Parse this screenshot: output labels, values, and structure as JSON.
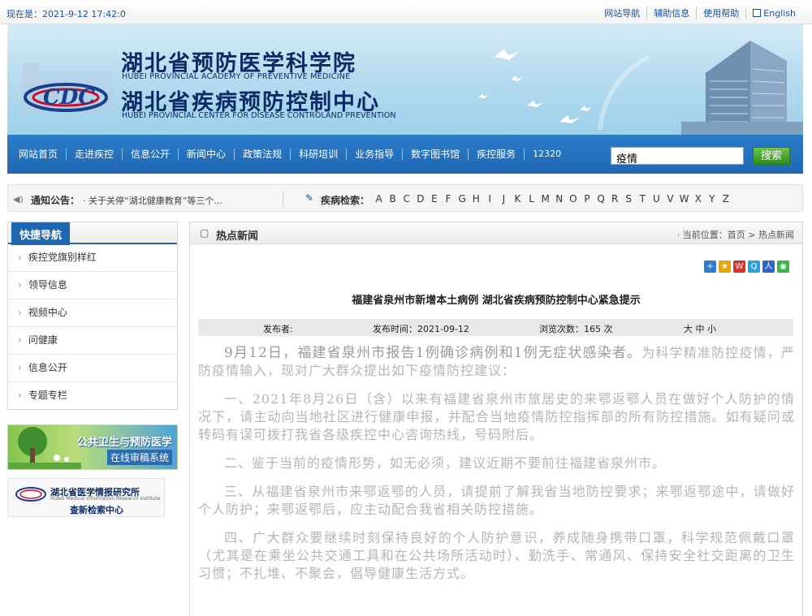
{
  "topbar": {
    "time": "现在是：2021-9-12 17:42:0",
    "links": [
      "网站导航",
      "辅助信息",
      "使用帮助",
      "English"
    ]
  },
  "banner": {
    "title_cn_1": "湖北省预防医学科学院",
    "title_en_1": "HUBEI PROVINCIAL ACADEMY OF PREVENTIVE MEDICINE",
    "title_cn_2": "湖北省疾病预防控制中心",
    "title_en_2": "HUBEI PROVINCIAL CENTER FOR DISEASE CONTROLAND PREVENTION",
    "logo_text": "CDC"
  },
  "nav": {
    "items": [
      "网站首页",
      "走进疾控",
      "信息公开",
      "新闻中心",
      "政策法规",
      "科研培训",
      "业务指导",
      "数字图书馆",
      "疾控服务",
      "12320"
    ],
    "search_value": "疫情",
    "search_button": "搜索"
  },
  "notice": {
    "label": "通知公告：",
    "text": "· 关于关停“湖北健康教育”等三个...",
    "disease_label": "疾病检索：",
    "letters": [
      "A",
      "B",
      "C",
      "D",
      "E",
      "F",
      "G",
      "H",
      "I",
      "J",
      "K",
      "L",
      "M",
      "N",
      "O",
      "P",
      "Q",
      "R",
      "S",
      "T",
      "U",
      "V",
      "W",
      "X",
      "Y",
      "Z"
    ]
  },
  "sidebar": {
    "title": "快捷导航",
    "items": [
      "疾控党旗别样红",
      "领导信息",
      "视频中心",
      "问健康",
      "信息公开",
      "专题专栏"
    ],
    "promo1_line1": "公共卫生与预防医学",
    "promo1_line2": "在线审稿系统",
    "promo2_title": "湖北省医学情报研究所",
    "promo2_sub": "Hubei Medical Information Research Institute",
    "promo2_bottom": "查新检索中心"
  },
  "main": {
    "section_title": "热点新闻",
    "breadcrumb": "· 当前位置：首页 > 热点新闻",
    "article_title": "福建省泉州市新增本土病例 湖北省疾病预防控制中心紧急提示",
    "meta": {
      "publisher": "发布者:",
      "publish_time": "发布时间：2021-09-12",
      "views": "浏览次数：165 次",
      "font_size": "大 中 小"
    },
    "lead": "9月12日，福建省泉州市报告1例确诊病例和1例无症状感染者。",
    "p1_rest": "为科学精准防控疫情，严防疫情输入，现对广大群众提出如下疫情防控建议：",
    "paragraphs": [
      "一、2021年8月26日（含）以来有福建省泉州市旅居史的来鄂返鄂人员在做好个人防护的情况下，请主动向当地社区进行健康申报，并配合当地疫情防控指挥部的所有防控措施。如有疑问或转码有误可拨打我省各级疾控中心咨询热线，号码附后。",
      "二、鉴于当前的疫情形势，如无必须，建议近期不要前往福建省泉州市。",
      "三、从福建省泉州市来鄂返鄂的人员，请提前了解我省当地防控要求；来鄂返鄂途中，请做好个人防护；来鄂返鄂后，应主动配合我省相关防控措施。",
      "四、广大群众要继续时刻保持良好的个人防护意识，养成随身携带口罩，科学规范佩戴口罩（尤其是在乘坐公共交通工具和在公共场所活动时）、勤洗手、常通风、保持安全社交距离的卫生习惯；不扎堆、不聚会，倡导健康生活方式。"
    ]
  },
  "colors": {
    "nav_blue": "#1f67b3",
    "title_navy": "#0c2a66",
    "search_green": "#2d8f1d"
  }
}
